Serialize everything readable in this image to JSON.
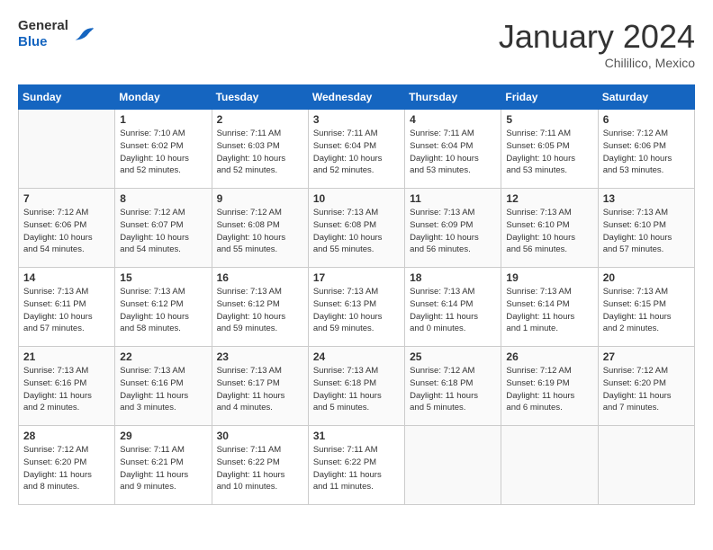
{
  "header": {
    "logo": {
      "line1": "General",
      "line2": "Blue"
    },
    "title": "January 2024",
    "subtitle": "Chililico, Mexico"
  },
  "weekdays": [
    "Sunday",
    "Monday",
    "Tuesday",
    "Wednesday",
    "Thursday",
    "Friday",
    "Saturday"
  ],
  "weeks": [
    [
      {
        "day": "",
        "info": ""
      },
      {
        "day": "1",
        "info": "Sunrise: 7:10 AM\nSunset: 6:02 PM\nDaylight: 10 hours\nand 52 minutes."
      },
      {
        "day": "2",
        "info": "Sunrise: 7:11 AM\nSunset: 6:03 PM\nDaylight: 10 hours\nand 52 minutes."
      },
      {
        "day": "3",
        "info": "Sunrise: 7:11 AM\nSunset: 6:04 PM\nDaylight: 10 hours\nand 52 minutes."
      },
      {
        "day": "4",
        "info": "Sunrise: 7:11 AM\nSunset: 6:04 PM\nDaylight: 10 hours\nand 53 minutes."
      },
      {
        "day": "5",
        "info": "Sunrise: 7:11 AM\nSunset: 6:05 PM\nDaylight: 10 hours\nand 53 minutes."
      },
      {
        "day": "6",
        "info": "Sunrise: 7:12 AM\nSunset: 6:06 PM\nDaylight: 10 hours\nand 53 minutes."
      }
    ],
    [
      {
        "day": "7",
        "info": "Sunrise: 7:12 AM\nSunset: 6:06 PM\nDaylight: 10 hours\nand 54 minutes."
      },
      {
        "day": "8",
        "info": "Sunrise: 7:12 AM\nSunset: 6:07 PM\nDaylight: 10 hours\nand 54 minutes."
      },
      {
        "day": "9",
        "info": "Sunrise: 7:12 AM\nSunset: 6:08 PM\nDaylight: 10 hours\nand 55 minutes."
      },
      {
        "day": "10",
        "info": "Sunrise: 7:13 AM\nSunset: 6:08 PM\nDaylight: 10 hours\nand 55 minutes."
      },
      {
        "day": "11",
        "info": "Sunrise: 7:13 AM\nSunset: 6:09 PM\nDaylight: 10 hours\nand 56 minutes."
      },
      {
        "day": "12",
        "info": "Sunrise: 7:13 AM\nSunset: 6:10 PM\nDaylight: 10 hours\nand 56 minutes."
      },
      {
        "day": "13",
        "info": "Sunrise: 7:13 AM\nSunset: 6:10 PM\nDaylight: 10 hours\nand 57 minutes."
      }
    ],
    [
      {
        "day": "14",
        "info": "Sunrise: 7:13 AM\nSunset: 6:11 PM\nDaylight: 10 hours\nand 57 minutes."
      },
      {
        "day": "15",
        "info": "Sunrise: 7:13 AM\nSunset: 6:12 PM\nDaylight: 10 hours\nand 58 minutes."
      },
      {
        "day": "16",
        "info": "Sunrise: 7:13 AM\nSunset: 6:12 PM\nDaylight: 10 hours\nand 59 minutes."
      },
      {
        "day": "17",
        "info": "Sunrise: 7:13 AM\nSunset: 6:13 PM\nDaylight: 10 hours\nand 59 minutes."
      },
      {
        "day": "18",
        "info": "Sunrise: 7:13 AM\nSunset: 6:14 PM\nDaylight: 11 hours\nand 0 minutes."
      },
      {
        "day": "19",
        "info": "Sunrise: 7:13 AM\nSunset: 6:14 PM\nDaylight: 11 hours\nand 1 minute."
      },
      {
        "day": "20",
        "info": "Sunrise: 7:13 AM\nSunset: 6:15 PM\nDaylight: 11 hours\nand 2 minutes."
      }
    ],
    [
      {
        "day": "21",
        "info": "Sunrise: 7:13 AM\nSunset: 6:16 PM\nDaylight: 11 hours\nand 2 minutes."
      },
      {
        "day": "22",
        "info": "Sunrise: 7:13 AM\nSunset: 6:16 PM\nDaylight: 11 hours\nand 3 minutes."
      },
      {
        "day": "23",
        "info": "Sunrise: 7:13 AM\nSunset: 6:17 PM\nDaylight: 11 hours\nand 4 minutes."
      },
      {
        "day": "24",
        "info": "Sunrise: 7:13 AM\nSunset: 6:18 PM\nDaylight: 11 hours\nand 5 minutes."
      },
      {
        "day": "25",
        "info": "Sunrise: 7:12 AM\nSunset: 6:18 PM\nDaylight: 11 hours\nand 5 minutes."
      },
      {
        "day": "26",
        "info": "Sunrise: 7:12 AM\nSunset: 6:19 PM\nDaylight: 11 hours\nand 6 minutes."
      },
      {
        "day": "27",
        "info": "Sunrise: 7:12 AM\nSunset: 6:20 PM\nDaylight: 11 hours\nand 7 minutes."
      }
    ],
    [
      {
        "day": "28",
        "info": "Sunrise: 7:12 AM\nSunset: 6:20 PM\nDaylight: 11 hours\nand 8 minutes."
      },
      {
        "day": "29",
        "info": "Sunrise: 7:11 AM\nSunset: 6:21 PM\nDaylight: 11 hours\nand 9 minutes."
      },
      {
        "day": "30",
        "info": "Sunrise: 7:11 AM\nSunset: 6:22 PM\nDaylight: 11 hours\nand 10 minutes."
      },
      {
        "day": "31",
        "info": "Sunrise: 7:11 AM\nSunset: 6:22 PM\nDaylight: 11 hours\nand 11 minutes."
      },
      {
        "day": "",
        "info": ""
      },
      {
        "day": "",
        "info": ""
      },
      {
        "day": "",
        "info": ""
      }
    ]
  ]
}
